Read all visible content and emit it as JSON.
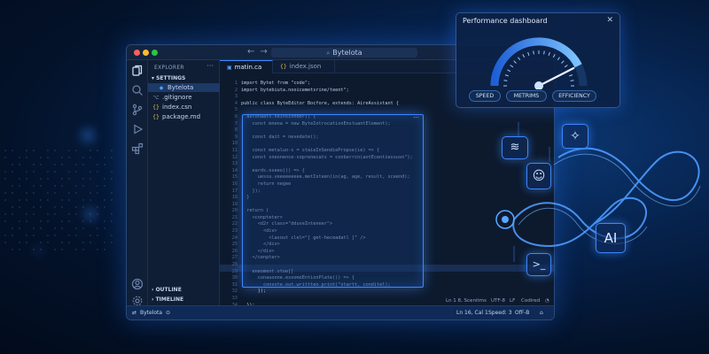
{
  "window": {
    "search_text": "Bytelota"
  },
  "sidebar": {
    "header": "EXPLORER",
    "section": "SETTINGS",
    "files": [
      {
        "name": "Bytelota",
        "icon": "js-file-icon"
      },
      {
        "name": ".gitignore",
        "icon": "git-file-icon"
      },
      {
        "name": "index.csn",
        "icon": "json-file-icon"
      },
      {
        "name": "package.md",
        "icon": "json-file-icon"
      }
    ],
    "outline": "OUTLINE",
    "timeline": "TIMELINE"
  },
  "tabs": [
    {
      "label": "matin.ca"
    },
    {
      "label": "index.json"
    }
  ],
  "code": {
    "lines": [
      "import Bytet from \"code\";",
      "import bytebiuta.nooicemetsrine/teent\";",
      "",
      "public class ByteEditor Bocfore, extends: AireAssistant {",
      "",
      "  autonaats.seinsinnder() {",
      "    const mnena = new ByteIotrocationEnstuantElement);",
      "",
      "    const dait = nevedate();",
      "",
      "    const metaluo-s = staieInSendiePropse(ie) => {",
      "    const sneonence-soprenecats = conberrcn(aotEcentiessusn\");",
      "",
      "    eards.oseeo(() => {",
      "      uessu.veeeeeeeee.metIsteen(in(ag, age, result, sceend);",
      "      return negee",
      "    });",
      "  }",
      "",
      "  return (",
      "    <conpteter>",
      "      <d2r class=\"dduveInteneer\">",
      "        <div>",
      "          <lasout clel=\"[ get-heceadatl ]\" />",
      "        </div>",
      "      </div>",
      "    </cenpter>",
      "",
      "    eneoment.stoe[[",
      "      conauoone.esoomoEntionPlate()) => {",
      "        consote.out.writtten.print(\"startt, conditel);",
      "      });",
      "",
      "  });",
      "}"
    ]
  },
  "status": {
    "branch": "Bytelota",
    "position": "Ln 16, Cal 1",
    "speed": "Speed: 3",
    "eol": "OfF-B",
    "top_ln": "Ln 1 8, Scenitms",
    "top_enc": "UTF-8",
    "top_lf": "LF",
    "top_mode": "Codired"
  },
  "dashboard": {
    "title": "Performance dashboard",
    "metrics": [
      "SPEED",
      "METRIMS",
      "EFFICIENCY"
    ],
    "gauge_level": 0.85,
    "accent": "#3d8bff"
  },
  "ai_graphics": {
    "ai_label": "AI"
  }
}
